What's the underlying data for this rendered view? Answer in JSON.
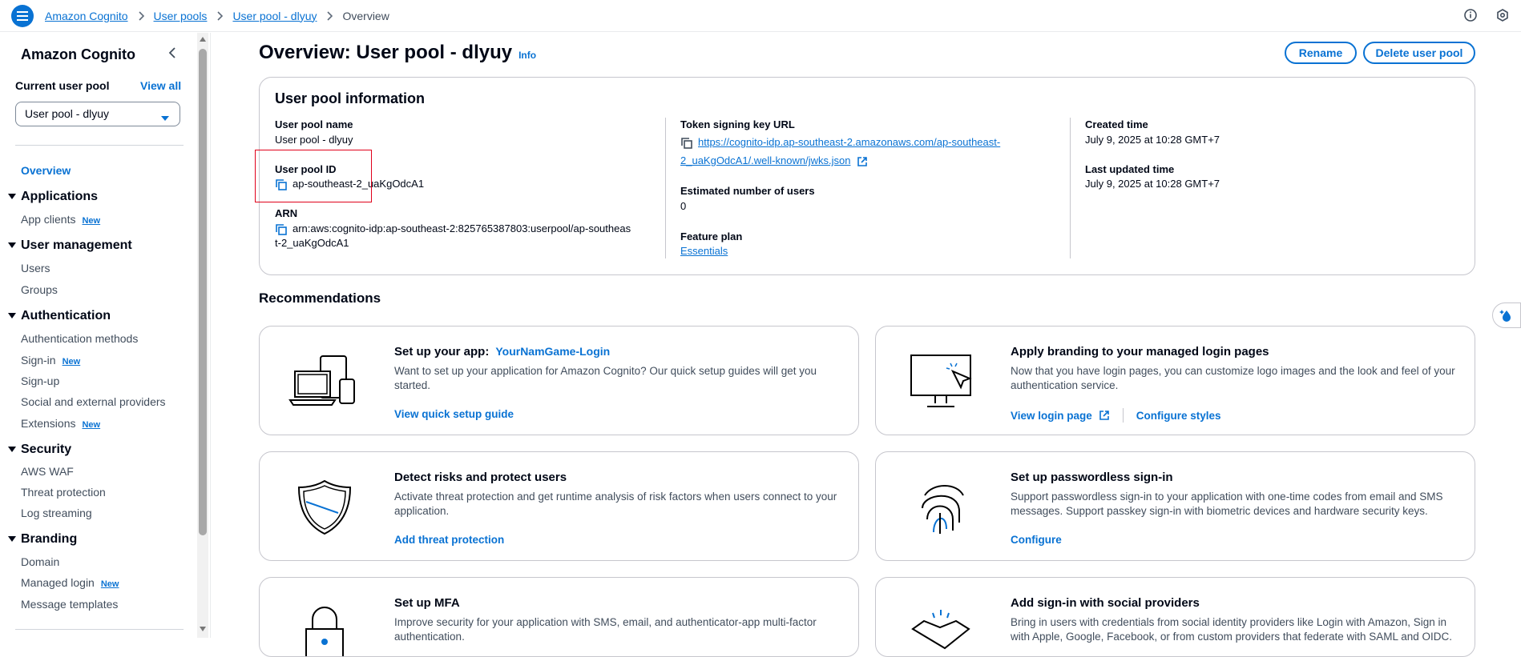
{
  "breadcrumbs": [
    "Amazon Cognito",
    "User pools",
    "User pool - dlyuy",
    "Overview"
  ],
  "sidebar": {
    "title": "Amazon Cognito",
    "current_pool_label": "Current user pool",
    "view_all": "View all",
    "selected_pool": "User pool - dlyuy",
    "overview": "Overview",
    "sections": [
      {
        "label": "Applications",
        "items": [
          {
            "label": "App clients",
            "badge": "New"
          }
        ]
      },
      {
        "label": "User management",
        "items": [
          {
            "label": "Users"
          },
          {
            "label": "Groups"
          }
        ]
      },
      {
        "label": "Authentication",
        "items": [
          {
            "label": "Authentication methods"
          },
          {
            "label": "Sign-in",
            "badge": "New"
          },
          {
            "label": "Sign-up"
          },
          {
            "label": "Social and external providers"
          },
          {
            "label": "Extensions",
            "badge": "New"
          }
        ]
      },
      {
        "label": "Security",
        "items": [
          {
            "label": "AWS WAF"
          },
          {
            "label": "Threat protection"
          },
          {
            "label": "Log streaming"
          }
        ]
      },
      {
        "label": "Branding",
        "items": [
          {
            "label": "Domain"
          },
          {
            "label": "Managed login",
            "badge": "New"
          },
          {
            "label": "Message templates"
          }
        ]
      }
    ]
  },
  "page": {
    "title": "Overview: User pool - dlyuy",
    "info": "Info",
    "rename": "Rename",
    "delete": "Delete user pool"
  },
  "pool_info": {
    "heading": "User pool information",
    "name_label": "User pool name",
    "name_value": "User pool - dlyuy",
    "id_label": "User pool ID",
    "id_value": "ap-southeast-2_uaKgOdcA1",
    "arn_label": "ARN",
    "arn_line1": "arn:aws:cognito-idp:ap-southeast-2:825765387803:userpool/ap-southeas",
    "arn_line2": "t-2_uaKgOdcA1",
    "token_label": "Token signing key URL",
    "token_line1": "https://cognito-idp.ap-southeast-2.amazonaws.com/ap-southeast-",
    "token_line2": "2_uaKgOdcA1/.well-known/jwks.json",
    "users_label": "Estimated number of users",
    "users_value": "0",
    "plan_label": "Feature plan",
    "plan_value": "Essentials",
    "created_label": "Created time",
    "created_value": "July 9, 2025 at 10:28 GMT+7",
    "updated_label": "Last updated time",
    "updated_value": "July 9, 2025 at 10:28 GMT+7"
  },
  "recommendations": {
    "heading": "Recommendations",
    "cards": [
      {
        "title": "Set up your app:",
        "subtitle": "YourNamGame-Login",
        "desc": "Want to set up your application for Amazon Cognito? Our quick setup guides will get you started.",
        "link": "View quick setup guide"
      },
      {
        "title": "Apply branding to your managed login pages",
        "desc": "Now that you have login pages, you can customize logo images and the look and feel of your authentication service.",
        "link": "View login page",
        "link2": "Configure styles"
      },
      {
        "title": "Detect risks and protect users",
        "desc": "Activate threat protection and get runtime analysis of risk factors when users connect to your application.",
        "link": "Add threat protection"
      },
      {
        "title": "Set up passwordless sign-in",
        "desc": "Support passwordless sign-in to your application with one-time codes from email and SMS messages. Support passkey sign-in with biometric devices and hardware security keys.",
        "link": "Configure"
      },
      {
        "title": "Set up MFA",
        "desc": "Improve security for your application with SMS, email, and authenticator-app multi-factor authentication."
      },
      {
        "title": "Add sign-in with social providers",
        "desc": "Bring in users with credentials from social identity providers like Login with Amazon, Sign in with Apple, Google, Facebook, or from custom providers that federate with SAML and OIDC."
      }
    ]
  },
  "colors": {
    "accent": "#0972d3",
    "highlight": "#e0001b"
  }
}
